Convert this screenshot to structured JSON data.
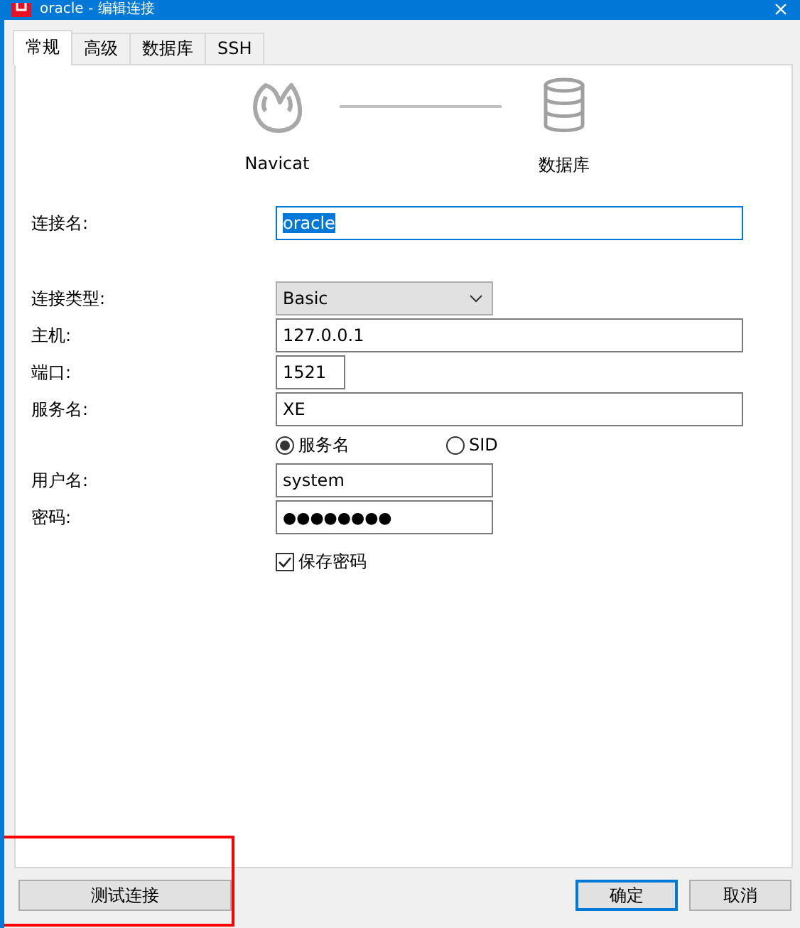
{
  "window": {
    "title": "oracle - 编辑连接"
  },
  "tabs": [
    {
      "label": "常规",
      "selected": true
    },
    {
      "label": "高级",
      "selected": false
    },
    {
      "label": "数据库",
      "selected": false
    },
    {
      "label": "SSH",
      "selected": false
    }
  ],
  "diagram": {
    "left_label": "Navicat",
    "right_label": "数据库"
  },
  "rows": [
    {
      "kind": "text",
      "label": "连接名:",
      "value": "oracle",
      "focused": true
    },
    {
      "kind": "select",
      "label": "连接类型:",
      "value": "Basic"
    },
    {
      "kind": "text",
      "label": "主机:",
      "value": "127.0.0.1",
      "focused": false
    },
    {
      "kind": "text",
      "label": "端口:",
      "value": "1521",
      "focused": false
    },
    {
      "kind": "text",
      "label": "服务名:",
      "value": "XE",
      "focused": false
    },
    {
      "kind": "radios",
      "options": [
        {
          "label": "服务名",
          "selected": true
        },
        {
          "label": "SID",
          "selected": false
        }
      ]
    },
    {
      "kind": "text",
      "label": "用户名:",
      "value": "system",
      "focused": false
    },
    {
      "kind": "password",
      "label": "密码:",
      "value": "●●●●●●●●"
    },
    {
      "kind": "checkbox",
      "label": "保存密码",
      "checked": true
    }
  ],
  "buttons": {
    "test": "测试连接",
    "ok": "确定",
    "cancel": "取消"
  }
}
